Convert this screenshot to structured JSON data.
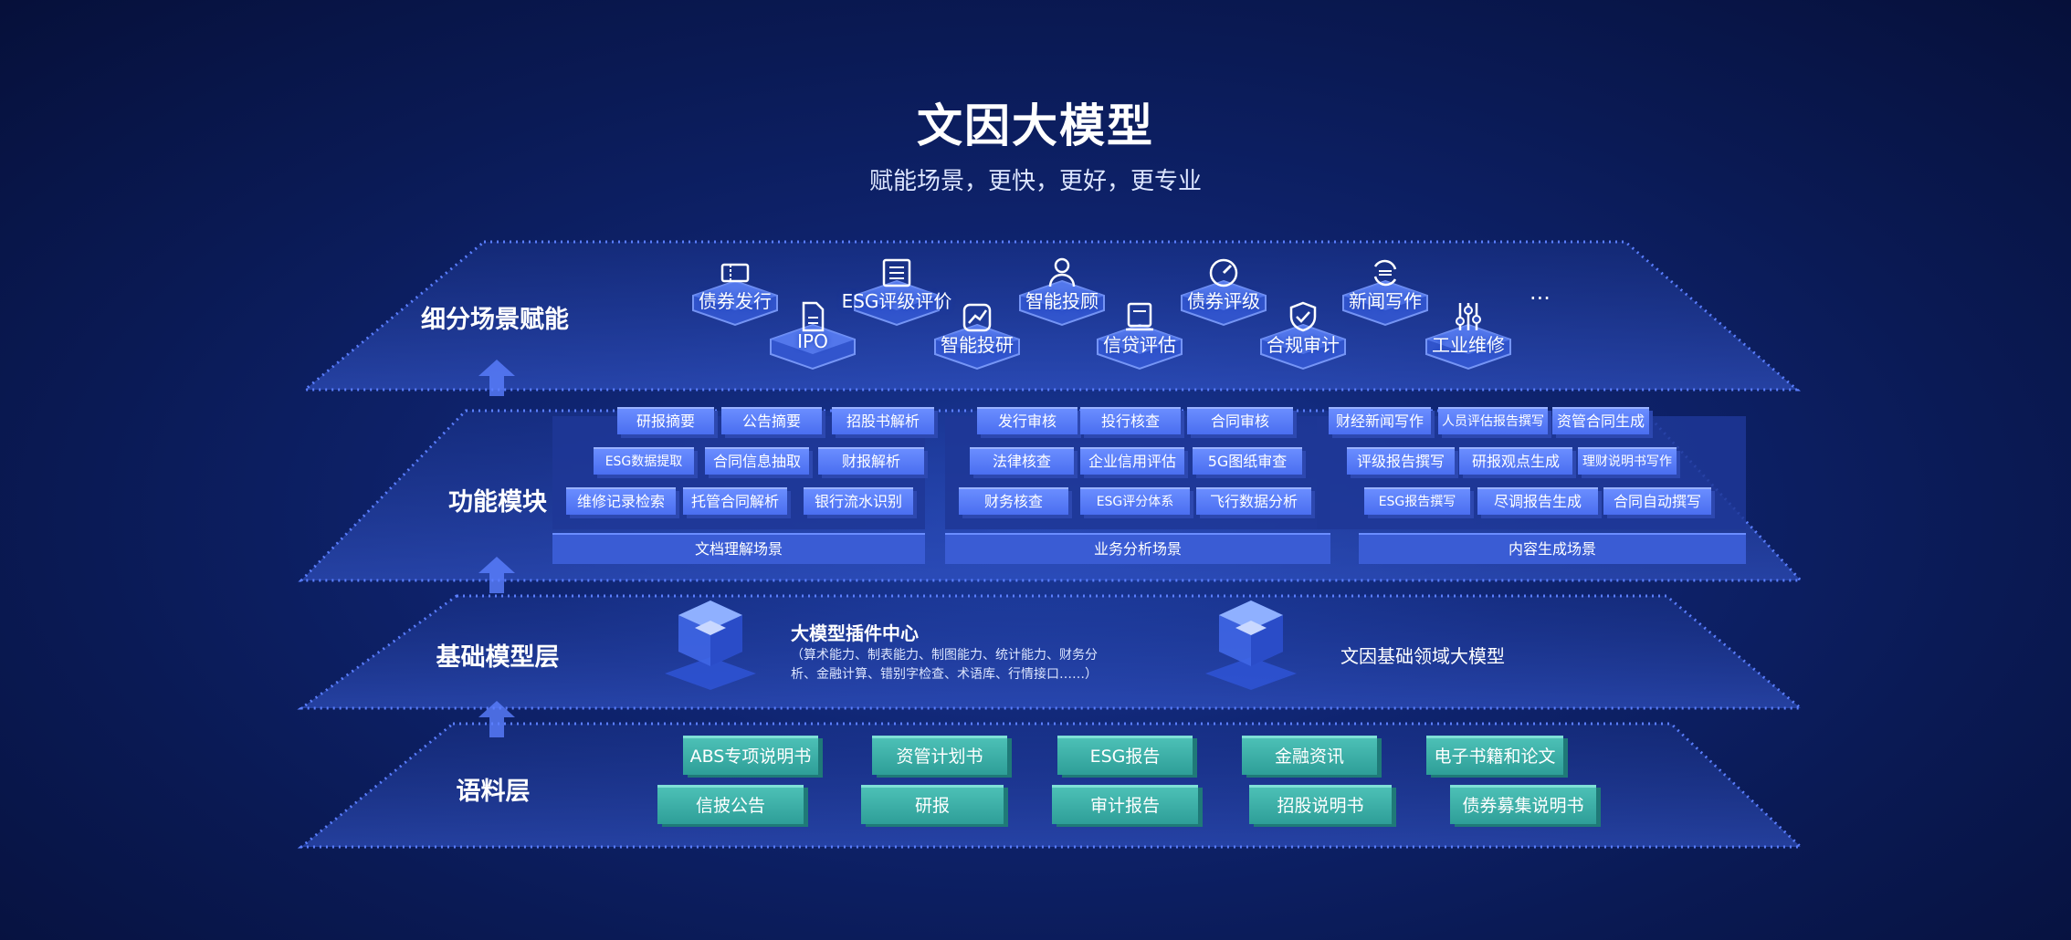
{
  "title": "文因大模型",
  "subtitle": "赋能场景，更快，更好，更专业",
  "layers": {
    "scene": "细分场景赋能",
    "function": "功能模块",
    "base": "基础模型层",
    "corpus": "语料层"
  },
  "scenarios": [
    {
      "label": "债券发行",
      "icon": "ticket-icon"
    },
    {
      "label": "IPO",
      "icon": "document-icon"
    },
    {
      "label": "ESG评级评价",
      "icon": "list-icon"
    },
    {
      "label": "智能投研",
      "icon": "chart-icon"
    },
    {
      "label": "智能投顾",
      "icon": "person-icon"
    },
    {
      "label": "信贷评估",
      "icon": "note-icon"
    },
    {
      "label": "债券评级",
      "icon": "gauge-icon"
    },
    {
      "label": "合规审计",
      "icon": "shield-icon"
    },
    {
      "label": "新闻写作",
      "icon": "refresh-icon"
    },
    {
      "label": "工业维修",
      "icon": "sliders-icon"
    }
  ],
  "scenarios_more": "...",
  "groups": [
    {
      "name": "文档理解场景",
      "rows": [
        [
          "研报摘要",
          "公告摘要",
          "招股书解析"
        ],
        [
          "ESG数据提取",
          "合同信息抽取",
          "财报解析"
        ],
        [
          "维修记录检索",
          "托管合同解析",
          "银行流水识别"
        ]
      ]
    },
    {
      "name": "业务分析场景",
      "rows": [
        [
          "发行审核",
          "投行核查",
          "合同审核"
        ],
        [
          "法律核查",
          "企业信用评估",
          "5G图纸审查"
        ],
        [
          "财务核查",
          "ESG评分体系",
          "飞行数据分析"
        ]
      ]
    },
    {
      "name": "内容生成场景",
      "rows": [
        [
          "财经新闻写作",
          "人员评估报告撰写",
          "资管合同生成"
        ],
        [
          "评级报告撰写",
          "研报观点生成",
          "理财说明书写作"
        ],
        [
          "ESG报告撰写",
          "尽调报告生成",
          "合同自动撰写"
        ]
      ]
    }
  ],
  "plugin": {
    "title": "大模型插件中心",
    "desc_line1": "（算术能力、制表能力、制图能力、统计能力、财务分",
    "desc_line2": "析、金融计算、错别字检查、术语库、行情接口……）"
  },
  "domain_model": "文因基础领域大模型",
  "corpus_row1": [
    "ABS专项说明书",
    "资管计划书",
    "ESG报告",
    "金融资讯",
    "电子书籍和论文"
  ],
  "corpus_row2": [
    "信披公告",
    "研报",
    "审计报告",
    "招股说明书",
    "债券募集说明书"
  ],
  "colors": {
    "accent": "#5b7fff",
    "corpus": "#3fb3ab",
    "dots": "#4f73ff"
  }
}
